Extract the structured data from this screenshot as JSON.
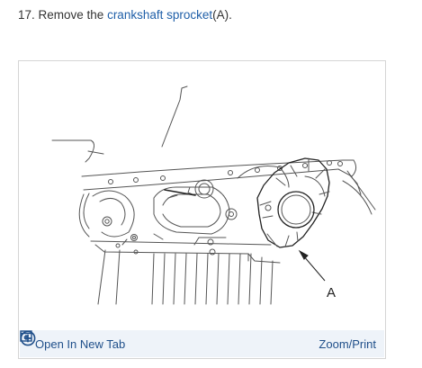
{
  "instruction": {
    "prefix": "17. Remove the ",
    "link_text": "crankshaft sprocket",
    "suffix": "(A)."
  },
  "figure": {
    "callout_label": "A",
    "open_tab_label": "Open In New Tab",
    "zoom_label": "Zoom/Print",
    "open_tab_icon": "open-in-new-tab-icon",
    "zoom_icon": "plus-circle-icon"
  },
  "colors": {
    "link": "#1f5fa8",
    "toolbar_bg": "#eef3f9",
    "toolbar_text": "#1f4f8a"
  }
}
